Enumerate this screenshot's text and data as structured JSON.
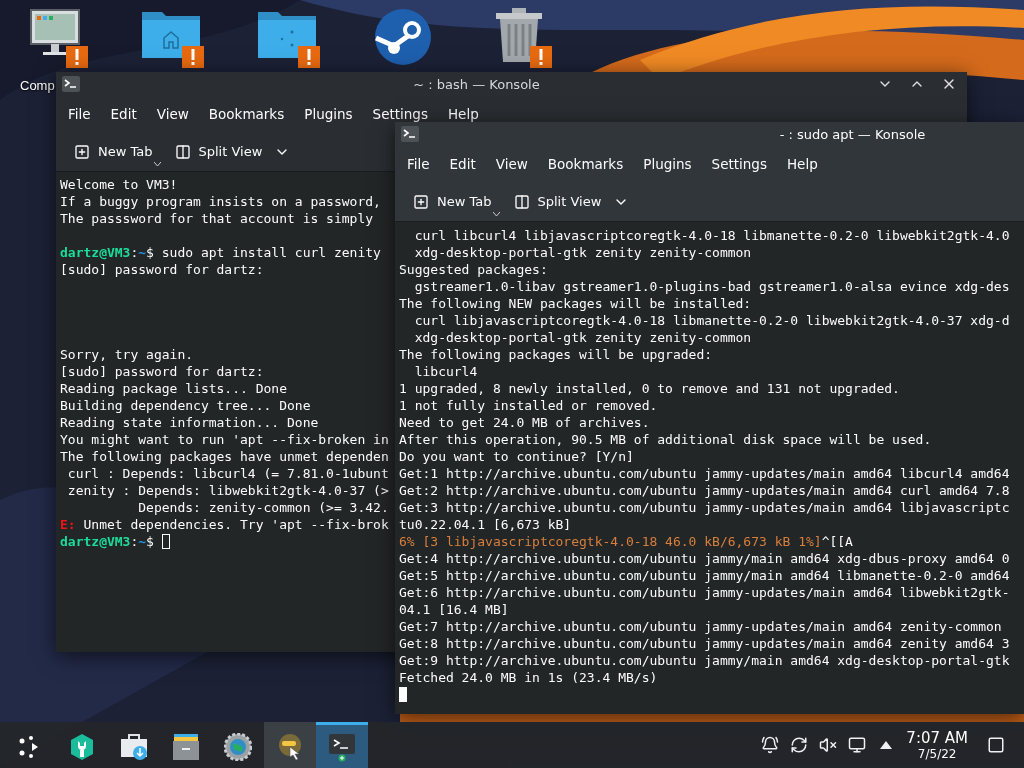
{
  "desktop_icons": [
    {
      "kind": "computer",
      "label": "Comp",
      "warning": true
    },
    {
      "kind": "home-folder",
      "warning": true
    },
    {
      "kind": "folder",
      "warning": true
    },
    {
      "kind": "steam",
      "warning": false
    },
    {
      "kind": "trash",
      "warning": true
    }
  ],
  "windows": [
    {
      "title": "~ : bash — Konsole",
      "active": false,
      "controls": true,
      "menu": [
        "File",
        "Edit",
        "View",
        "Bookmarks",
        "Plugins",
        "Settings",
        "Help"
      ],
      "toolbar": [
        {
          "kind": "new-tab",
          "label": "New Tab"
        },
        {
          "kind": "split-view",
          "label": "Split View"
        }
      ],
      "lines": [
        {
          "kind": "output",
          "text": "Welcome to VM3!"
        },
        {
          "kind": "output",
          "text": "If a buggy program insists on a password,"
        },
        {
          "kind": "output",
          "text": "The passsword for that account is simply"
        },
        {
          "kind": "blank"
        },
        {
          "kind": "prompt",
          "user": "dartz@VM3",
          "sep": ":",
          "path": "~",
          "symbol": "$",
          "text": " sudo apt install curl zenity",
          "cursor": false
        },
        {
          "kind": "output",
          "text": "[sudo] password for dartz:"
        },
        {
          "kind": "blank"
        },
        {
          "kind": "blank"
        },
        {
          "kind": "blank"
        },
        {
          "kind": "blank"
        },
        {
          "kind": "output",
          "text": "Sorry, try again."
        },
        {
          "kind": "output",
          "text": "[sudo] password for dartz:"
        },
        {
          "kind": "output",
          "text": "Reading package lists... Done"
        },
        {
          "kind": "output",
          "text": "Building dependency tree... Done"
        },
        {
          "kind": "output",
          "text": "Reading state information... Done"
        },
        {
          "kind": "output",
          "text": "You might want to run 'apt --fix-broken in"
        },
        {
          "kind": "output",
          "text": "The following packages have unmet dependen"
        },
        {
          "kind": "output",
          "text": " curl : Depends: libcurl4 (= 7.81.0-1ubunt"
        },
        {
          "kind": "output",
          "text": " zenity : Depends: libwebkit2gtk-4.0-37 (>"
        },
        {
          "kind": "output",
          "text": "          Depends: zenity-common (>= 3.42."
        },
        {
          "kind": "error",
          "prefix": "E:",
          "text": " Unmet dependencies. Try 'apt --fix-brok"
        },
        {
          "kind": "prompt",
          "user": "dartz@VM3",
          "sep": ":",
          "path": "~",
          "symbol": "$",
          "cursor": true
        }
      ]
    },
    {
      "title": "- : sudo apt — Konsole",
      "active": true,
      "controls": false,
      "menu": [
        "File",
        "Edit",
        "View",
        "Bookmarks",
        "Plugins",
        "Settings",
        "Help"
      ],
      "toolbar": [
        {
          "kind": "new-tab",
          "label": "New Tab"
        },
        {
          "kind": "split-view",
          "label": "Split View"
        }
      ],
      "lines": [
        {
          "kind": "output",
          "text": "  curl libcurl4 libjavascriptcoregtk-4.0-18 libmanette-0.2-0 libwebkit2gtk-4.0"
        },
        {
          "kind": "output",
          "text": "  xdg-desktop-portal-gtk zenity zenity-common"
        },
        {
          "kind": "output",
          "text": "Suggested packages:"
        },
        {
          "kind": "output",
          "text": "  gstreamer1.0-libav gstreamer1.0-plugins-bad gstreamer1.0-alsa evince xdg-des"
        },
        {
          "kind": "output",
          "text": "The following NEW packages will be installed:"
        },
        {
          "kind": "output",
          "text": "  curl libjavascriptcoregtk-4.0-18 libmanette-0.2-0 libwebkit2gtk-4.0-37 xdg-d"
        },
        {
          "kind": "output",
          "text": "  xdg-desktop-portal-gtk zenity zenity-common"
        },
        {
          "kind": "output",
          "text": "The following packages will be upgraded:"
        },
        {
          "kind": "output",
          "text": "  libcurl4"
        },
        {
          "kind": "output",
          "text": "1 upgraded, 8 newly installed, 0 to remove and 131 not upgraded."
        },
        {
          "kind": "output",
          "text": "1 not fully installed or removed."
        },
        {
          "kind": "output",
          "text": "Need to get 24.0 MB of archives."
        },
        {
          "kind": "output",
          "text": "After this operation, 90.5 MB of additional disk space will be used."
        },
        {
          "kind": "output",
          "text": "Do you want to continue? [Y/n]"
        },
        {
          "kind": "output",
          "text": "Get:1 http://archive.ubuntu.com/ubuntu jammy-updates/main amd64 libcurl4 amd64"
        },
        {
          "kind": "output",
          "text": "Get:2 http://archive.ubuntu.com/ubuntu jammy-updates/main amd64 curl amd64 7.8"
        },
        {
          "kind": "output",
          "text": "Get:3 http://archive.ubuntu.com/ubuntu jammy-updates/main amd64 libjavascriptc"
        },
        {
          "kind": "output",
          "text": "tu0.22.04.1 [6,673 kB]"
        },
        {
          "kind": "progress",
          "text": "6% [3 libjavascriptcoregtk-4.0-18 46.0 kB/6,673 kB 1%]",
          "suffix": "^[[A"
        },
        {
          "kind": "output",
          "text": "Get:4 http://archive.ubuntu.com/ubuntu jammy/main amd64 xdg-dbus-proxy amd64 0"
        },
        {
          "kind": "output",
          "text": "Get:5 http://archive.ubuntu.com/ubuntu jammy/main amd64 libmanette-0.2-0 amd64"
        },
        {
          "kind": "output",
          "text": "Get:6 http://archive.ubuntu.com/ubuntu jammy-updates/main amd64 libwebkit2gtk-"
        },
        {
          "kind": "output",
          "text": "04.1 [16.4 MB]"
        },
        {
          "kind": "output",
          "text": "Get:7 http://archive.ubuntu.com/ubuntu jammy-updates/main amd64 zenity-common"
        },
        {
          "kind": "output",
          "text": "Get:8 http://archive.ubuntu.com/ubuntu jammy-updates/main amd64 zenity amd64 3"
        },
        {
          "kind": "output",
          "text": "Get:9 http://archive.ubuntu.com/ubuntu jammy/main amd64 xdg-desktop-portal-gtk"
        },
        {
          "kind": "output",
          "text": "Fetched 24.0 MB in 1s (23.4 MB/s)"
        },
        {
          "kind": "cursor"
        }
      ]
    }
  ],
  "taskbar": {
    "launchers": [
      {
        "kind": "launcher",
        "selected": false,
        "hovered": false
      },
      {
        "kind": "wrench",
        "selected": false,
        "hovered": false
      },
      {
        "kind": "store",
        "selected": false,
        "hovered": false
      },
      {
        "kind": "archive",
        "selected": false,
        "hovered": false
      },
      {
        "kind": "globe-gear",
        "selected": false,
        "hovered": false
      },
      {
        "kind": "maps",
        "selected": false,
        "hovered": true
      },
      {
        "kind": "terminal",
        "selected": true,
        "hovered": false
      }
    ],
    "tray": [
      {
        "kind": "alarm"
      },
      {
        "kind": "sync"
      },
      {
        "kind": "muted"
      },
      {
        "kind": "network"
      },
      {
        "kind": "expand"
      }
    ],
    "clock": {
      "time": "7:07 AM",
      "date": "7/5/22"
    }
  }
}
